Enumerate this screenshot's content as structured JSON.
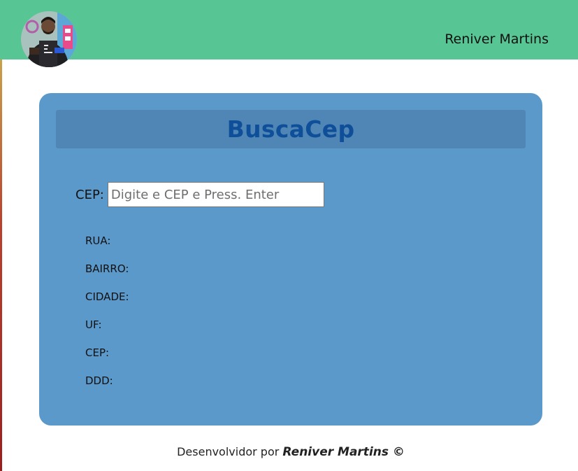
{
  "header": {
    "brand_name": "Reniver Martins",
    "avatar": {
      "icon": "user-avatar",
      "shirt_text": "BACK\nEND\nDEVELOPER"
    }
  },
  "card": {
    "title": "BuscaCep",
    "search": {
      "label": "CEP:",
      "placeholder": "Digite e CEP e Press. Enter",
      "value": ""
    },
    "fields": [
      {
        "label": "RUA:"
      },
      {
        "label": "BAIRRO:"
      },
      {
        "label": "CIDADE:"
      },
      {
        "label": "UF:"
      },
      {
        "label": "CEP:"
      },
      {
        "label": "DDD:"
      }
    ]
  },
  "footer": {
    "prefix": "Desenvolvidor por",
    "author": "Reniver Martins ©"
  },
  "colors": {
    "header_bg": "#57c594",
    "card_bg": "#5b99cb",
    "title_bar_bg": "#5086b5",
    "title_text": "#0f4f9a"
  }
}
